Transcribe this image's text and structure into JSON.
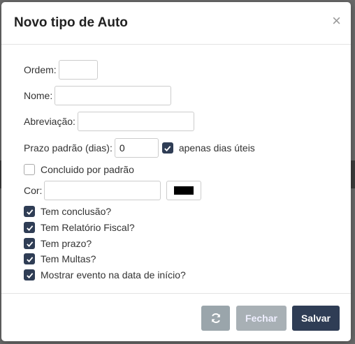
{
  "modal": {
    "title": "Novo tipo de Auto",
    "close_glyph": "×"
  },
  "form": {
    "ordem_label": "Ordem:",
    "ordem_value": "",
    "nome_label": "Nome:",
    "nome_value": "",
    "abreviacao_label": "Abreviação:",
    "abreviacao_value": "",
    "prazo_label": "Prazo padrão (dias):",
    "prazo_value": "0",
    "dias_uteis_label": "apenas dias úteis",
    "dias_uteis_checked": true,
    "concluido_label": "Concluido por padrão",
    "concluido_checked": false,
    "cor_label": "Cor:",
    "cor_value": "",
    "cor_swatch": "#000000",
    "options": [
      {
        "label": "Tem conclusão?",
        "checked": true
      },
      {
        "label": "Tem Relatório Fiscal?",
        "checked": true
      },
      {
        "label": "Tem prazo?",
        "checked": true
      },
      {
        "label": "Tem Multas?",
        "checked": true
      },
      {
        "label": "Mostrar evento na data de início?",
        "checked": true
      }
    ]
  },
  "footer": {
    "refresh_icon": "refresh-icon",
    "fechar_label": "Fechar",
    "salvar_label": "Salvar"
  },
  "colors": {
    "primary": "#2f3d55",
    "secondary": "#a8b0b5"
  }
}
